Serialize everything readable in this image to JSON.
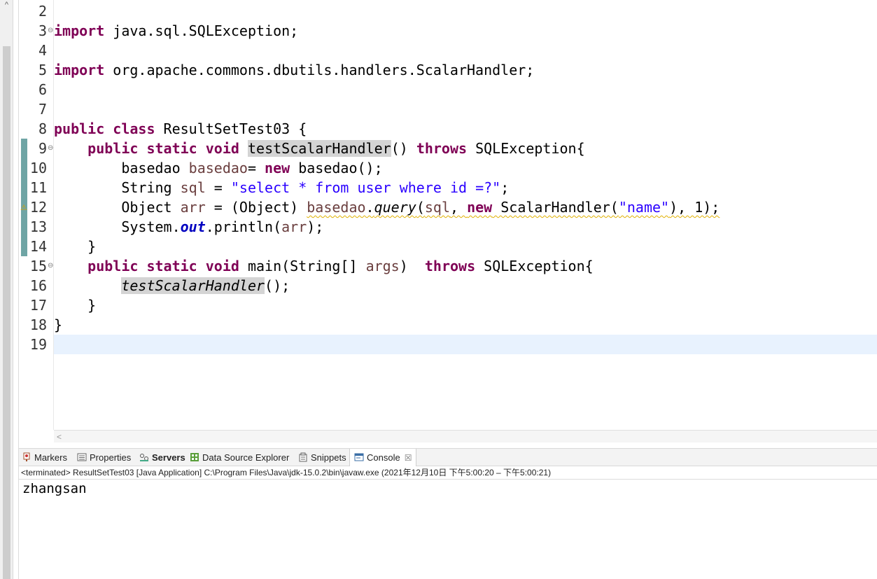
{
  "editor": {
    "line_numbers": [
      "2",
      "3",
      "4",
      "5",
      "6",
      "7",
      "8",
      "9",
      "10",
      "11",
      "12",
      "13",
      "14",
      "15",
      "16",
      "17",
      "18",
      "19"
    ],
    "code": {
      "l3": {
        "kw": "import",
        "rest": " java.sql.SQLException;"
      },
      "l5": {
        "kw": "import",
        "rest": " org.apache.commons.dbutils.handlers.ScalarHandler;"
      },
      "l8": {
        "kw1": "public",
        "kw2": "class",
        "rest": " ResultSetTest03 {"
      },
      "l9": {
        "kw1": "public",
        "kw2": "static",
        "kw3": "void",
        "method": "testScalarHandler",
        "mid": "() ",
        "kw4": "throws",
        "rest": " SQLException{"
      },
      "l10": {
        "type": "basedao ",
        "var": "basedao",
        "mid": "= ",
        "kw": "new",
        "rest": " basedao();"
      },
      "l11": {
        "type": "String ",
        "var": "sql",
        "mid": " = ",
        "str": "\"select * from user where id =?\"",
        "rest": ";"
      },
      "l12": {
        "a": "Object ",
        "var1": "arr",
        "b": " = (Object) ",
        "var2": "basedao",
        "c": ".",
        "method": "query",
        "d": "(",
        "var3": "sql",
        "e": ", ",
        "kw": "new",
        "f": " ScalarHandler(",
        "str": "\"name\"",
        "g": "), 1);"
      },
      "l13": {
        "a": "System.",
        "field": "out",
        "b": ".println(",
        "var": "arr",
        "c": ");"
      },
      "l14": {
        "text": "}"
      },
      "l15": {
        "kw1": "public",
        "kw2": "static",
        "kw3": "void",
        "a": " main(String[] ",
        "var": "args",
        "b": ")  ",
        "kw4": "throws",
        "c": " SQLException{"
      },
      "l16": {
        "call": "testScalarHandler",
        "rest": "();"
      },
      "l17": {
        "text": "}"
      },
      "l18": {
        "text": "}"
      }
    }
  },
  "views": {
    "tabs": [
      {
        "label": "Markers"
      },
      {
        "label": "Properties"
      },
      {
        "label": "Servers"
      },
      {
        "label": "Data Source Explorer"
      },
      {
        "label": "Snippets"
      },
      {
        "label": "Console"
      }
    ],
    "close_glyph": "☒"
  },
  "console": {
    "status": "<terminated> ResultSetTest03 [Java Application] C:\\Program Files\\Java\\jdk-15.0.2\\bin\\javaw.exe  (2021年12月10日 下午5:00:20 – 下午5:00:21)",
    "output": "zhangsan"
  },
  "colors": {
    "keyword": "#7f0055",
    "string": "#2a00ff",
    "local_var": "#6a3e3e",
    "field": "#0000c0",
    "current_line": "#e8f2fe"
  }
}
